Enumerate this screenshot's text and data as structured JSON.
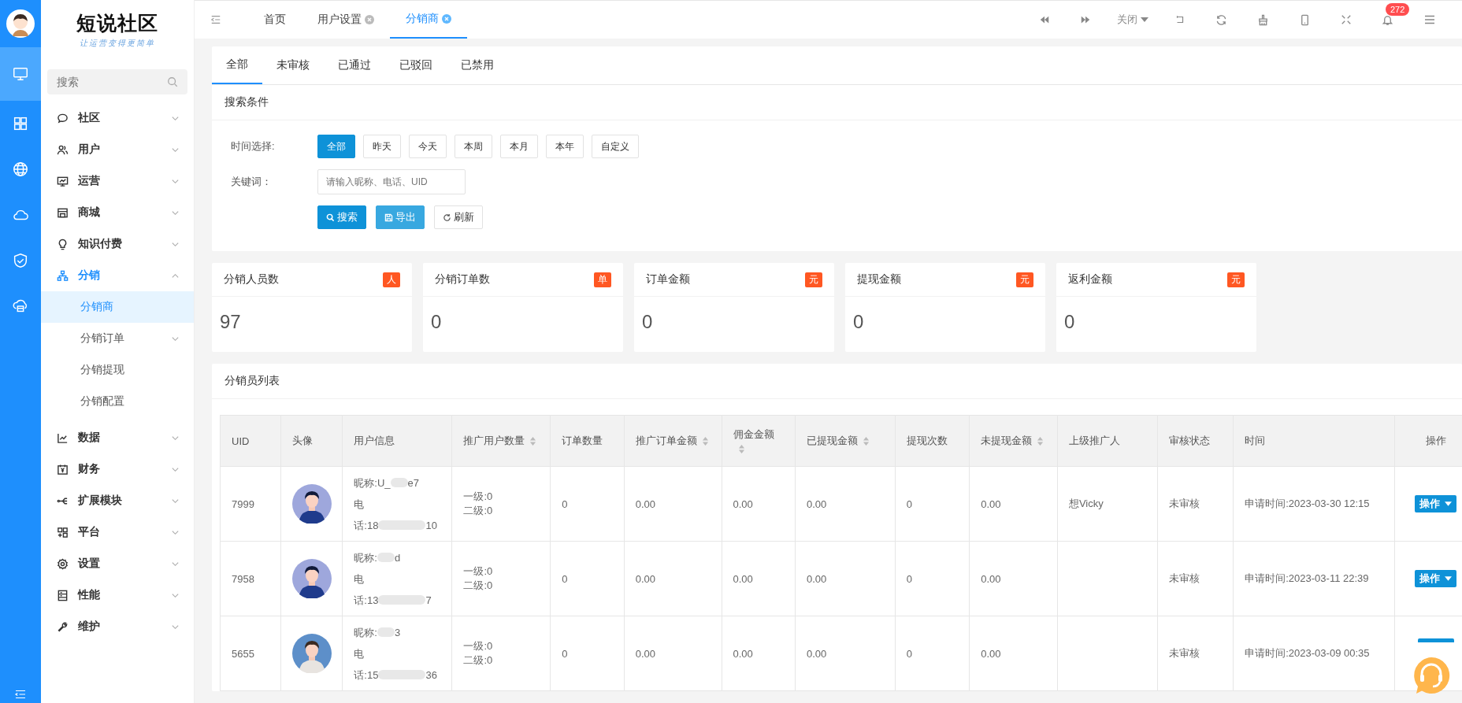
{
  "rail": {
    "items": [
      {
        "kind": "monitor",
        "selected": true
      },
      {
        "kind": "grid",
        "selected": false
      },
      {
        "kind": "globe",
        "selected": false
      },
      {
        "kind": "cloud",
        "selected": false
      },
      {
        "kind": "shield",
        "selected": false
      },
      {
        "kind": "cloud-box",
        "selected": false
      }
    ]
  },
  "sidebar": {
    "brand": "短说社区",
    "slogan": "让运营变得更简单",
    "search": {
      "placeholder": "搜索"
    },
    "items": [
      {
        "label": "社区",
        "kind": "chat",
        "expanded": false,
        "selected": false
      },
      {
        "label": "用户",
        "kind": "users",
        "expanded": false,
        "selected": false
      },
      {
        "label": "运营",
        "kind": "chart-board",
        "expanded": false,
        "selected": false
      },
      {
        "label": "商城",
        "kind": "shop",
        "expanded": false,
        "selected": false
      },
      {
        "label": "知识付费",
        "kind": "bulb",
        "expanded": false,
        "selected": false
      },
      {
        "label": "分销",
        "kind": "org",
        "expanded": true,
        "selected": true,
        "children": [
          {
            "label": "分销商",
            "selected": true,
            "expandable": false
          },
          {
            "label": "分销订单",
            "selected": false,
            "expandable": true
          },
          {
            "label": "分销提现",
            "selected": false,
            "expandable": false
          },
          {
            "label": "分销配置",
            "selected": false,
            "expandable": false
          }
        ]
      },
      {
        "label": "数据",
        "kind": "line-chart",
        "expanded": false,
        "selected": false
      },
      {
        "label": "财务",
        "kind": "yen",
        "expanded": false,
        "selected": false
      },
      {
        "label": "扩展模块",
        "kind": "branch",
        "expanded": false,
        "selected": false
      },
      {
        "label": "平台",
        "kind": "blocks",
        "expanded": false,
        "selected": false
      },
      {
        "label": "设置",
        "kind": "gear",
        "expanded": false,
        "selected": false
      },
      {
        "label": "性能",
        "kind": "server",
        "expanded": false,
        "selected": false
      },
      {
        "label": "维护",
        "kind": "wrench",
        "expanded": false,
        "selected": false
      }
    ]
  },
  "header": {
    "tabs": [
      {
        "label": "首页",
        "closable": false,
        "selected": false
      },
      {
        "label": "用户设置",
        "closable": true,
        "selected": false
      },
      {
        "label": "分销商",
        "closable": true,
        "selected": true
      }
    ],
    "close_menu": "关闭",
    "notification_count": "272"
  },
  "status_tabs": [
    {
      "label": "全部",
      "selected": true
    },
    {
      "label": "未审核",
      "selected": false
    },
    {
      "label": "已通过",
      "selected": false
    },
    {
      "label": "已驳回",
      "selected": false
    },
    {
      "label": "已禁用",
      "selected": false
    }
  ],
  "filter": {
    "title": "搜索条件",
    "time_label": "时间选择:",
    "time_options": [
      {
        "label": "全部",
        "selected": true
      },
      {
        "label": "昨天",
        "selected": false
      },
      {
        "label": "今天",
        "selected": false
      },
      {
        "label": "本周",
        "selected": false
      },
      {
        "label": "本月",
        "selected": false
      },
      {
        "label": "本年",
        "selected": false
      },
      {
        "label": "自定义",
        "selected": false
      }
    ],
    "keyword_label": "关键词：",
    "keyword": {
      "placeholder": "请输入昵称、电话、UID"
    },
    "buttons": [
      {
        "label": "搜索",
        "kind": "search"
      },
      {
        "label": "导出",
        "kind": "export"
      },
      {
        "label": "刷新",
        "kind": "refresh"
      }
    ]
  },
  "stats": [
    {
      "title": "分销人员数",
      "unit": "人",
      "value": "97"
    },
    {
      "title": "分销订单数",
      "unit": "单",
      "value": "0"
    },
    {
      "title": "订单金额",
      "unit": "元",
      "value": "0"
    },
    {
      "title": "提现金额",
      "unit": "元",
      "value": "0"
    },
    {
      "title": "返利金额",
      "unit": "元",
      "value": "0"
    }
  ],
  "table": {
    "title": "分销员列表",
    "columns": [
      {
        "label": "UID",
        "sortable": false
      },
      {
        "label": "头像",
        "sortable": false
      },
      {
        "label": "用户信息",
        "sortable": false
      },
      {
        "label": "推广用户数量",
        "sortable": true
      },
      {
        "label": "订单数量",
        "sortable": false
      },
      {
        "label": "推广订单金额",
        "sortable": true
      },
      {
        "label": "佣金金额",
        "sortable": true
      },
      {
        "label": "已提现金额",
        "sortable": true
      },
      {
        "label": "提现次数",
        "sortable": false
      },
      {
        "label": "未提现金额",
        "sortable": true
      },
      {
        "label": "上级推广人",
        "sortable": false
      },
      {
        "label": "审核状态",
        "sortable": false
      },
      {
        "label": "时间",
        "sortable": false
      },
      {
        "label": "操作",
        "sortable": false
      }
    ],
    "rows": [
      {
        "uid": "7999",
        "avatar": {
          "kind": "lavender"
        },
        "nick_head": "昵称:U_",
        "nick_tail": "e7",
        "phone_head": "电",
        "phone_line": "话:18",
        "phone_tail": "10",
        "level1": "一级:0",
        "level2": "二级:0",
        "orders": "0",
        "order_amount": "0.00",
        "commission": "0.00",
        "withdrawn": "0.00",
        "withdraw_count": "0",
        "unwithdrawn": "0.00",
        "referrer": "想Vicky",
        "status": "未审核",
        "time": "申请时间:2023-03-30 12:15",
        "action": "操作"
      },
      {
        "uid": "7958",
        "avatar": {
          "kind": "lavender"
        },
        "nick_head": "昵称:",
        "nick_tail": "d",
        "phone_head": "电",
        "phone_line": "话:13",
        "phone_tail": "7",
        "level1": "一级:0",
        "level2": "二级:0",
        "orders": "0",
        "order_amount": "0.00",
        "commission": "0.00",
        "withdrawn": "0.00",
        "withdraw_count": "0",
        "unwithdrawn": "0.00",
        "status": "未审核",
        "time": "申请时间:2023-03-11 22:39",
        "action": "操作"
      },
      {
        "uid": "5655",
        "avatar": {
          "kind": "steel"
        },
        "nick_head": "昵称:",
        "nick_tail": "3",
        "phone_head": "电",
        "phone_line": "话:15",
        "phone_tail": "36",
        "level1": "一级:0",
        "level2": "二级:0",
        "orders": "0",
        "order_amount": "0.00",
        "commission": "0.00",
        "withdrawn": "0.00",
        "withdraw_count": "0",
        "unwithdrawn": "0.00",
        "status": "未审核",
        "time": "申请时间:2023-03-09 00:35"
      }
    ]
  }
}
